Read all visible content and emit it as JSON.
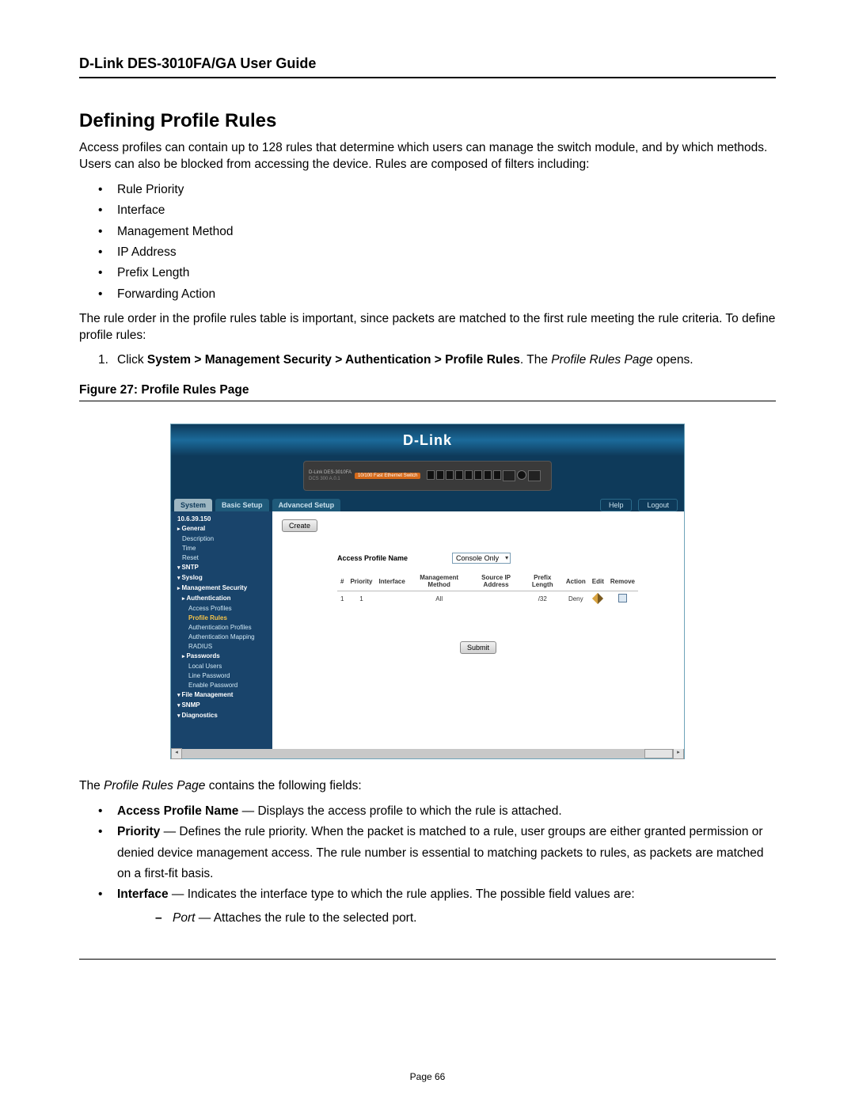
{
  "header": {
    "title": "D-Link DES-3010FA/GA User Guide"
  },
  "section": {
    "heading": "Defining Profile Rules",
    "intro": "Access profiles can contain up to 128 rules that determine which users can manage the switch module, and by which methods. Users can also be blocked from accessing the device. Rules are composed of filters including:",
    "filters": [
      "Rule Priority",
      "Interface",
      "Management Method",
      "IP Address",
      "Prefix Length",
      "Forwarding Action"
    ],
    "order_para": "The rule order in the profile rules table is important, since packets are matched to the first rule meeting the rule criteria. To define profile rules:",
    "step1_prefix": "Click ",
    "step1_bold": "System > Management Security > Authentication > Profile Rules",
    "step1_mid": ". The ",
    "step1_italic": "Profile Rules Page",
    "step1_suffix": " opens.",
    "figure_caption": "Figure 27:  Profile Rules Page",
    "fields_intro_pre": "The ",
    "fields_intro_it": "Profile Rules Page",
    "fields_intro_post": " contains the following fields:"
  },
  "fields": [
    {
      "name": "Access Profile Name",
      "desc": " — Displays the access profile to which the rule is attached."
    },
    {
      "name": "Priority",
      "desc": " — Defines the rule priority. When the packet is matched to a rule, user groups are either granted permission or denied device management access. The rule number is essential to matching packets to rules, as packets are matched on a first-fit basis."
    },
    {
      "name": "Interface",
      "desc": " — Indicates the interface type to which the rule applies. The possible field values are:"
    }
  ],
  "sub_port": {
    "it": "Port",
    "rest": " — Attaches the rule to the selected port."
  },
  "footer": {
    "page": "Page 66"
  },
  "shot": {
    "logo": "D-Link",
    "device_model": "D-Link DES-3010FA",
    "device_tag": "10/100 Fast Ethernet Switch",
    "dcs": "DCS 300 A.0.1",
    "tabs": {
      "system": "System",
      "basic": "Basic Setup",
      "advanced": "Advanced Setup"
    },
    "top": {
      "help": "Help",
      "logout": "Logout"
    },
    "tree": {
      "ip": "10.6.39.150",
      "items": [
        {
          "t": "General",
          "c": "tree-caret lvl0 bold"
        },
        {
          "t": "Description",
          "c": "lvl1"
        },
        {
          "t": "Time",
          "c": "lvl1"
        },
        {
          "t": "Reset",
          "c": "lvl1"
        },
        {
          "t": "SNTP",
          "c": "tree-caretd lvl0 bold"
        },
        {
          "t": "Syslog",
          "c": "tree-caretd lvl0 bold"
        },
        {
          "t": "Management Security",
          "c": "tree-caret lvl0 bold"
        },
        {
          "t": "Authentication",
          "c": "tree-caret lvl1 bold"
        },
        {
          "t": "Access Profiles",
          "c": "lvl2"
        },
        {
          "t": "Profile Rules",
          "c": "lvl2 sel"
        },
        {
          "t": "Authentication Profiles",
          "c": "lvl2"
        },
        {
          "t": "Authentication Mapping",
          "c": "lvl2"
        },
        {
          "t": "RADIUS",
          "c": "lvl2"
        },
        {
          "t": "Passwords",
          "c": "tree-caret lvl1 bold"
        },
        {
          "t": "Local Users",
          "c": "lvl2"
        },
        {
          "t": "Line Password",
          "c": "lvl2"
        },
        {
          "t": "Enable Password",
          "c": "lvl2"
        },
        {
          "t": "File Management",
          "c": "tree-caretd lvl0 bold"
        },
        {
          "t": "SNMP",
          "c": "tree-caretd lvl0 bold"
        },
        {
          "t": "Diagnostics",
          "c": "tree-caretd lvl0 bold"
        }
      ]
    },
    "content": {
      "create": "Create",
      "apn_label": "Access Profile Name",
      "apn_value": "Console Only",
      "columns": [
        "#",
        "Priority",
        "Interface",
        "Management Method",
        "Source IP Address",
        "Prefix Length",
        "Action",
        "Edit",
        "Remove"
      ],
      "row": {
        "n": "1",
        "priority": "1",
        "interface": "",
        "method": "All",
        "src": "",
        "prefix": "/32",
        "action": "Deny"
      },
      "submit": "Submit"
    }
  }
}
